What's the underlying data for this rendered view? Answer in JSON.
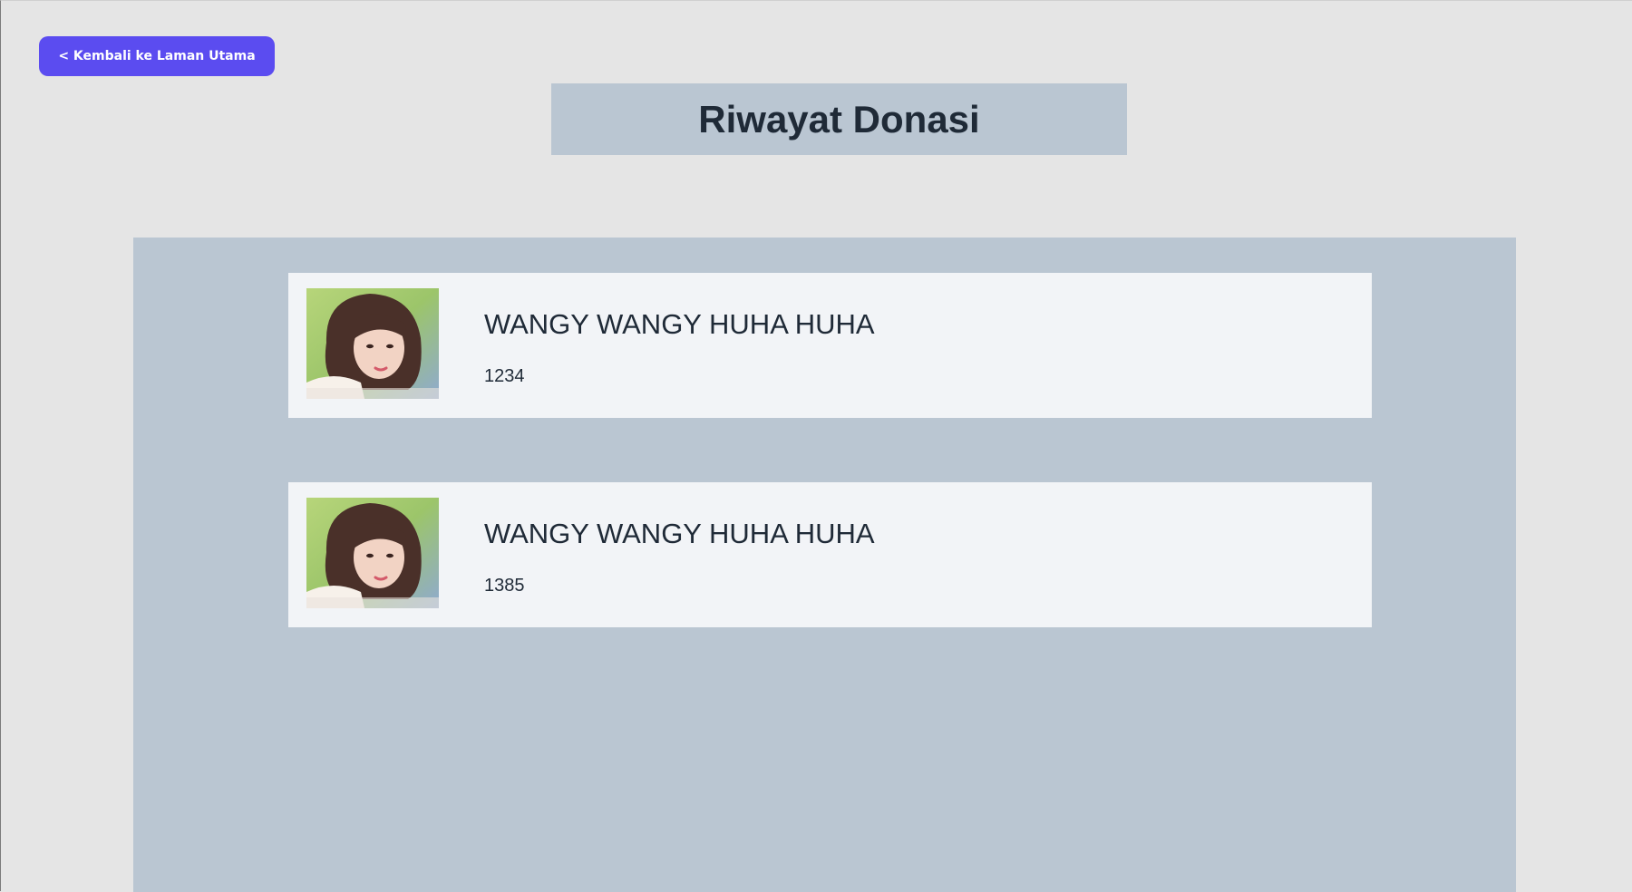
{
  "back_button": {
    "label": "< Kembali ke Laman Utama"
  },
  "page": {
    "title": "Riwayat Donasi"
  },
  "donations": [
    {
      "title": "WANGY WANGY HUHA HUHA",
      "amount": "1234"
    },
    {
      "title": "WANGY WANGY HUHA HUHA",
      "amount": "1385"
    }
  ],
  "colors": {
    "page_bg": "#e5e5e5",
    "accent_button": "#5b4cf0",
    "panel_bg": "#bac6d2",
    "card_bg": "#f2f4f7",
    "text": "#1f2a37"
  }
}
